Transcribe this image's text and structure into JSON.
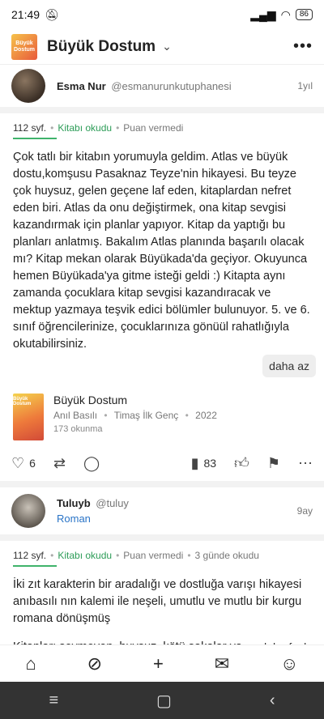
{
  "status": {
    "time": "21:49",
    "battery": "86"
  },
  "appbar": {
    "title": "Büyük Dostum",
    "cover_text": "Büyük Dostum"
  },
  "review1": {
    "name": "Esma Nur",
    "handle": "@esmanurunkutuphanesi",
    "time": "1yıl",
    "pages": "112 syf.",
    "read_status": "Kitabı okudu",
    "rating": "Puan vermedi",
    "text": "Çok tatlı bir kitabın yorumuyla geldim. Atlas ve büyük dostu,komşusu Pasaknaz Teyze'nin hikayesi. Bu teyze çok huysuz, gelen geçene laf eden, kitaplardan nefret eden biri. Atlas da onu değiştirmek, ona kitap sevgisi kazandırmak için planlar yapıyor. Kitap da yaptığı bu planları anlatmış. Bakalım Atlas planında başarılı olacak mı? Kitap mekan olarak Büyükada'da geçiyor. Okuyunca hemen Büyükada'ya gitme isteği geldi :) Kitapta aynı zamanda çocuklara kitap sevgisi kazandıracak ve mektup yazmaya teşvik edici bölümler bulunuyor. 5. ve 6. sınıf öğrencilerinize, çocuklarınıza gönüül rahatlığıyla okutabilirsiniz.",
    "less_label": "daha az",
    "book": {
      "title": "Büyük Dostum",
      "author": "Anıl Basılı",
      "publisher": "Timaş İlk Genç",
      "year": "2022",
      "reads": "173 okunma"
    },
    "likes": "6",
    "views": "83"
  },
  "review2": {
    "name": "Tuluyb",
    "handle": "@tuluy",
    "time": "9ay",
    "shelf": "Roman",
    "pages": "112 syf.",
    "read_status": "Kitabı okudu",
    "rating": "Puan vermedi",
    "duration": "3 günde okudu",
    "text1": "İki zıt karakterin bir aradalığı ve dostluğa varışı hikayesi anıbasılı nın kalemi ile neşeli, umutlu ve mutlu bir kurgu romana dönüşmüş",
    "text2": "Kitapları sevmeyen, huysuz, kötü şakalar ya",
    "more_label": "daha fazla"
  }
}
